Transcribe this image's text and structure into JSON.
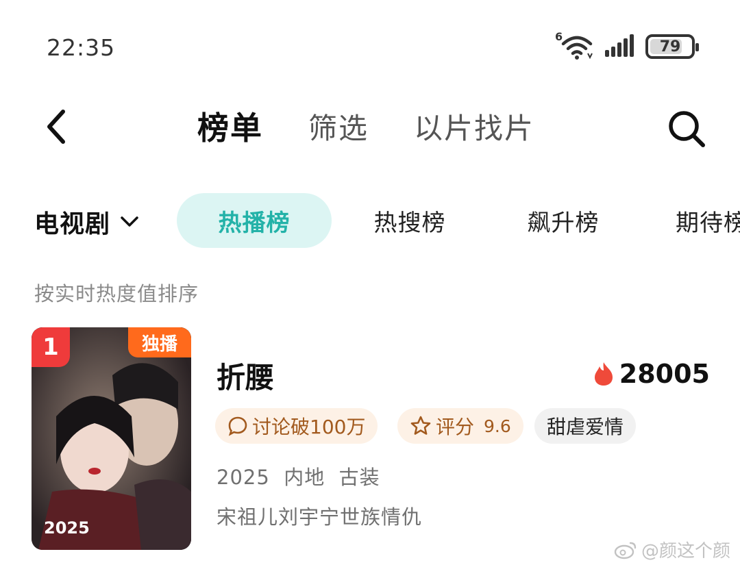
{
  "status_bar": {
    "time": "22:35",
    "wifi_label": "6",
    "battery_level": "79",
    "battery_fraction": 0.79,
    "icons": [
      "wifi-icon",
      "signal-icon",
      "battery-icon"
    ]
  },
  "nav": {
    "back_icon": "chevron-left-icon",
    "tabs": [
      {
        "label": "榜单",
        "active": true
      },
      {
        "label": "筛选",
        "active": false
      },
      {
        "label": "以片找片",
        "active": false
      }
    ],
    "search_icon": "search-icon"
  },
  "category": {
    "selected": "电视剧",
    "icon": "chevron-down-icon"
  },
  "rank_tabs": [
    {
      "label": "热播榜",
      "active": true
    },
    {
      "label": "热搜榜",
      "active": false
    },
    {
      "label": "飙升榜",
      "active": false
    },
    {
      "label": "期待榜",
      "active": false
    }
  ],
  "sort_hint": "按实时热度值排序",
  "items": [
    {
      "rank": "1",
      "badge": "独播",
      "poster_year": "2025",
      "title": "折腰",
      "heat": "28005",
      "tags": {
        "discuss": "讨论破100万",
        "score_label": "评分",
        "score_value": "9.6",
        "genre": "甜虐爱情"
      },
      "meta": "2025  内地  古装",
      "cast": "宋祖儿刘宇宁世族情仇"
    }
  ],
  "watermark": "@颜这个颜",
  "colors": {
    "accent": "#23b2a8",
    "accent_bg": "#dcf5f3",
    "rank_badge": "#ef3b3b",
    "exclusive_badge": "#ff6a1c",
    "heat_icon": "#ef4a3a",
    "tag_warm_bg": "#fdf1e6",
    "tag_warm_text": "#a25a1e"
  }
}
